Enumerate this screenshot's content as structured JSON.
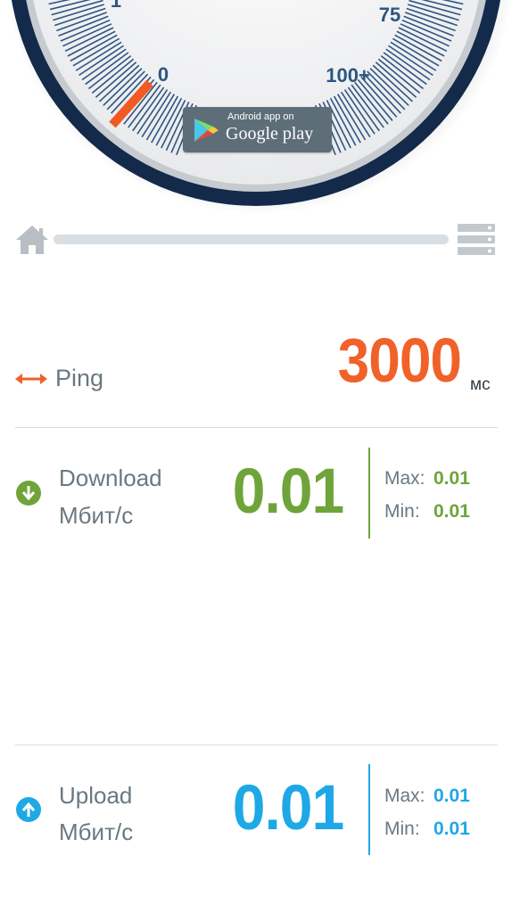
{
  "gauge": {
    "ticks": [
      "1",
      "0",
      "75",
      "100+"
    ],
    "needle_value": 0
  },
  "google_play": {
    "top_text": "Android app on",
    "main_text": "Google play"
  },
  "progress": {
    "fraction": 0.0
  },
  "ping": {
    "label": "Ping",
    "value": "3000",
    "unit": "мс"
  },
  "download": {
    "label": "Download",
    "unit": "Мбит/с",
    "value": "0.01",
    "max_label": "Max:",
    "max_value": "0.01",
    "min_label": "Min:",
    "min_value": "0.01"
  },
  "upload": {
    "label": "Upload",
    "unit": "Мбит/с",
    "value": "0.01",
    "max_label": "Max:",
    "max_value": "0.01",
    "min_label": "Min:",
    "min_value": "0.01"
  },
  "colors": {
    "ping": "#f0622a",
    "download": "#6fa43a",
    "upload": "#1ea8e6",
    "gauge_ring": "#132a4a",
    "gauge_ticks": "#2d5582"
  },
  "icons": {
    "home": "home-icon",
    "server": "server-list-icon",
    "ping": "double-arrow-icon",
    "download": "arrow-down-circle-icon",
    "upload": "arrow-up-circle-icon",
    "play": "google-play-icon"
  }
}
